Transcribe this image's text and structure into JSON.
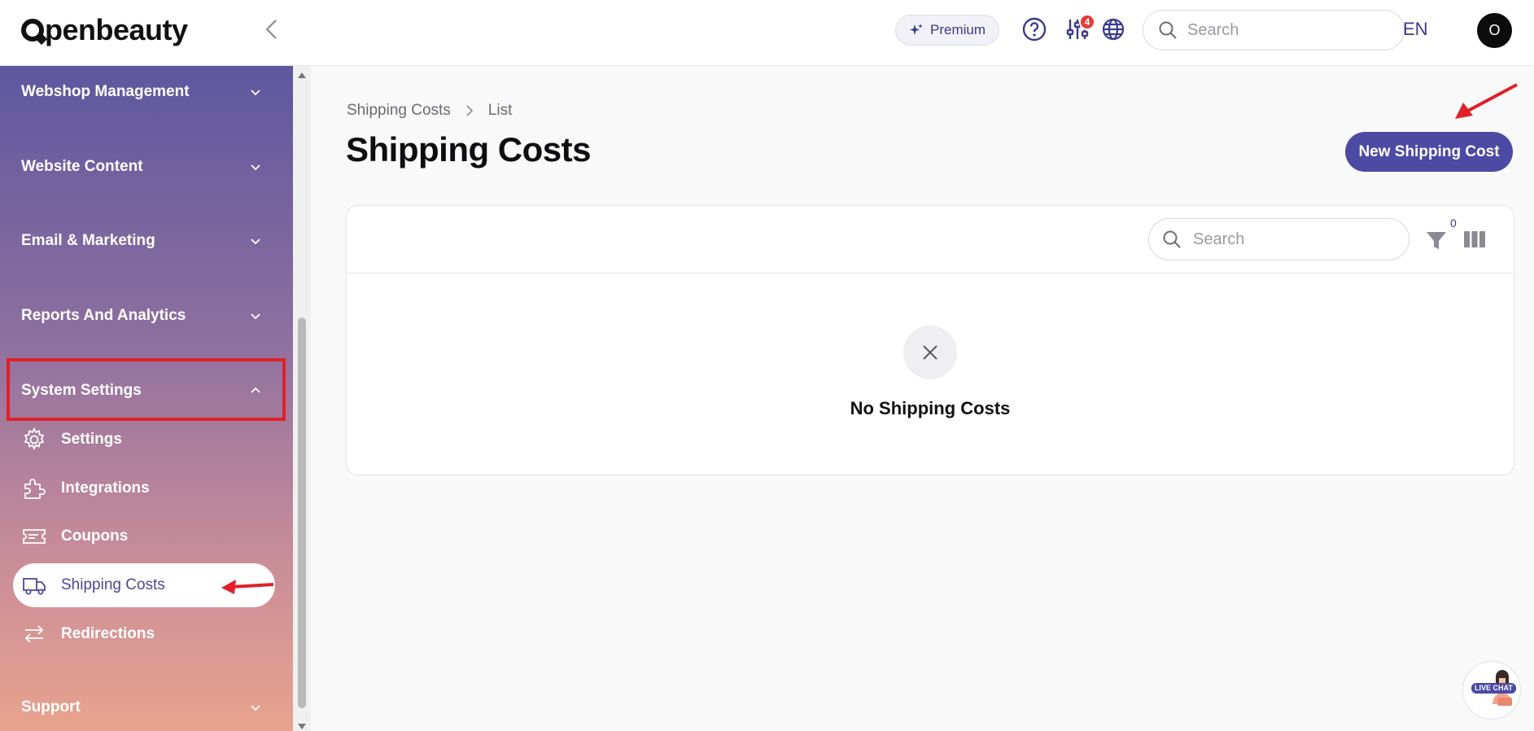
{
  "brand": {
    "logo_text": "penbeauty"
  },
  "topbar": {
    "premium_label": "Premium",
    "notification_count": "4",
    "search_placeholder": "Search",
    "language": "EN",
    "avatar_initial": "O"
  },
  "sidebar": {
    "sections": [
      {
        "label": "Webshop Management",
        "expanded": false
      },
      {
        "label": "Website Content",
        "expanded": false
      },
      {
        "label": "Email & Marketing",
        "expanded": false
      },
      {
        "label": "Reports And Analytics",
        "expanded": false
      },
      {
        "label": "System Settings",
        "expanded": true
      },
      {
        "label": "Support",
        "expanded": false
      }
    ],
    "items": [
      {
        "label": "Settings",
        "icon": "gear-icon"
      },
      {
        "label": "Integrations",
        "icon": "puzzle-icon"
      },
      {
        "label": "Coupons",
        "icon": "ticket-icon"
      },
      {
        "label": "Shipping Costs",
        "icon": "truck-icon",
        "active": true
      },
      {
        "label": "Redirections",
        "icon": "arrows-icon"
      }
    ]
  },
  "breadcrumb": {
    "parent": "Shipping Costs",
    "current": "List"
  },
  "page": {
    "title": "Shipping Costs",
    "new_button": "New Shipping Cost"
  },
  "table": {
    "search_placeholder": "Search",
    "filter_count": "0",
    "empty_message": "No Shipping Costs"
  },
  "chat": {
    "label": "LIVE CHAT"
  },
  "colors": {
    "accent": "#4d4aa3",
    "highlight": "#e0202a"
  }
}
